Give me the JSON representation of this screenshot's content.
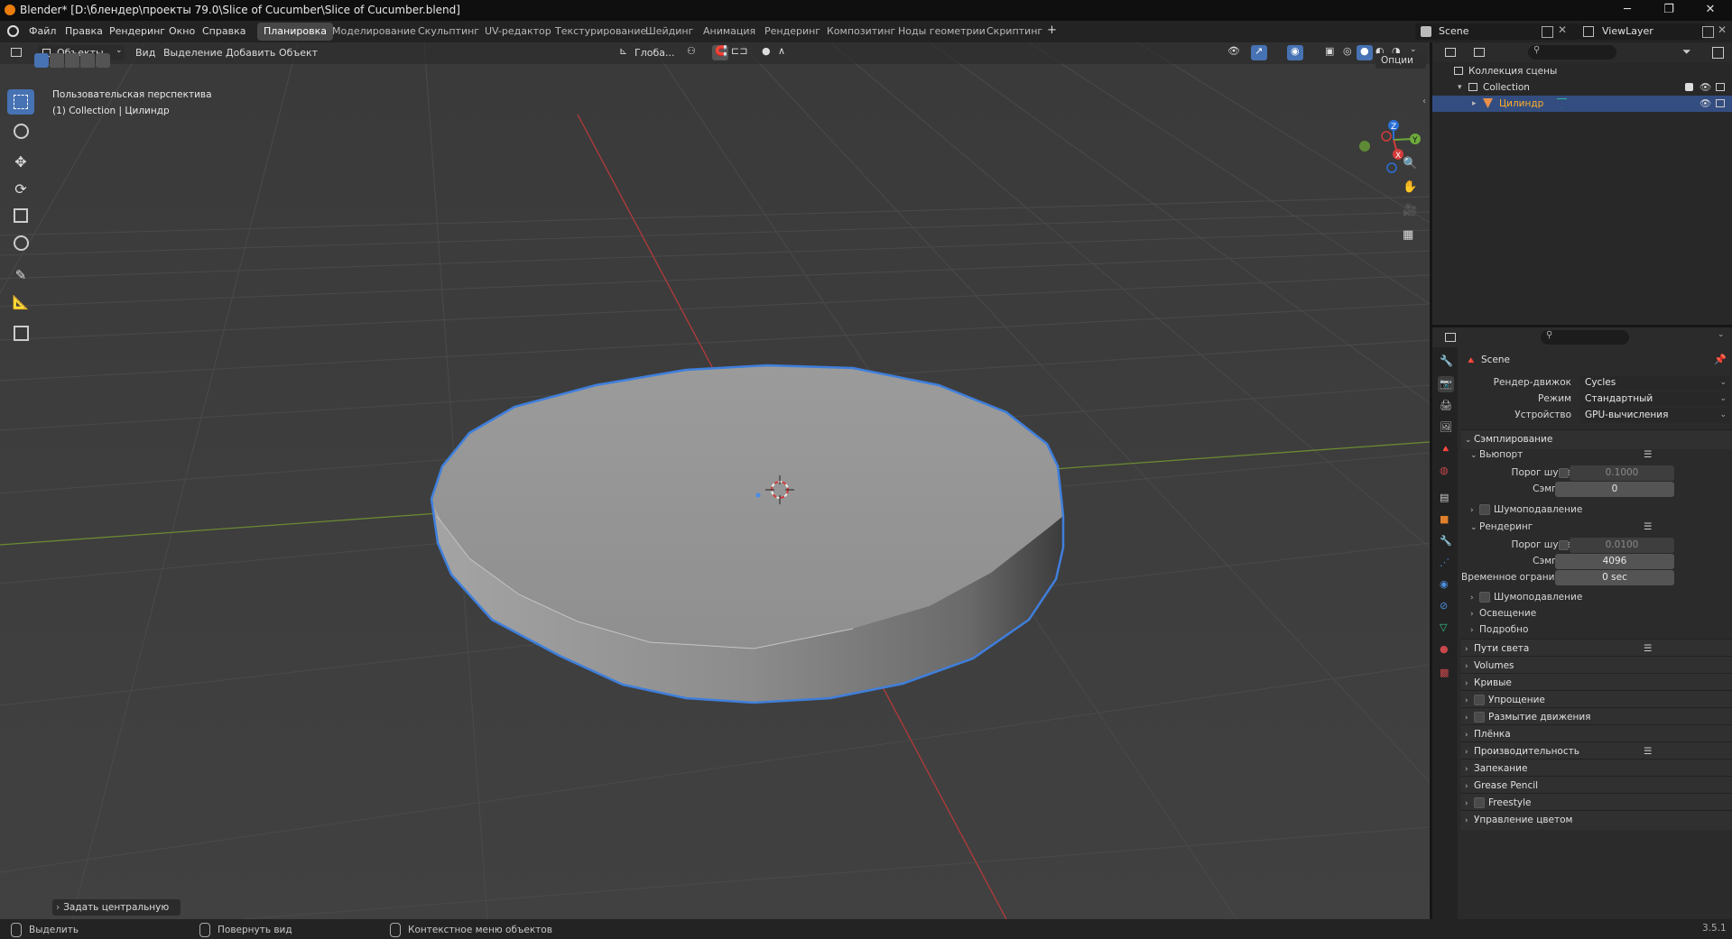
{
  "window": {
    "title": "Blender* [D:\\блендер\\проекты 79.0\\Slice of Cucumber\\Slice of Cucumber.blend]",
    "minimize": "─",
    "maximize": "❐",
    "close": "✕"
  },
  "topbar": {
    "menus": [
      "Файл",
      "Правка",
      "Рендеринг",
      "Окно",
      "Справка"
    ],
    "workspaces": [
      "Планировка",
      "Моделирование",
      "Скульптинг",
      "UV-редактор",
      "Текстурирование",
      "Шейдинг",
      "Анимация",
      "Рендеринг",
      "Композитинг",
      "Ноды геометрии",
      "Скриптинг"
    ],
    "active_workspace_index": 0,
    "add_workspace": "+",
    "scene": "Scene",
    "view_layer": "ViewLayer"
  },
  "viewport_header": {
    "mode": "Объекты",
    "menus": [
      "Вид",
      "Выделение",
      "Добавить",
      "Объект"
    ],
    "transform_orientation": "Глоба...",
    "options": "Опции"
  },
  "viewport": {
    "view_name": "Пользовательская перспектива",
    "collection_info": "(1) Collection | Цилиндр",
    "last_operator": "Задать центральную точ",
    "accent_color": "#4772b3",
    "selection_outline_color": "#3f7fdc"
  },
  "outliner": {
    "root": "Коллекция сцены",
    "collection": "Collection",
    "object": "Цилиндр"
  },
  "properties": {
    "context_name": "Scene",
    "render_engine_label": "Рендер-движок",
    "render_engine": "Cycles",
    "mode_label": "Режим",
    "mode": "Стандартный",
    "device_label": "Устройство",
    "device": "GPU-вычисления",
    "sampling": "Сэмплирование",
    "viewport": "Вьюпорт",
    "noise_threshold_label": "Порог шума",
    "viewport_noise_threshold": "0.1000",
    "samples_label": "Сэмплы",
    "viewport_samples": "0",
    "denoise": "Шумоподавление",
    "render": "Рендеринг",
    "render_noise_threshold": "0.0100",
    "render_samples": "4096",
    "time_limit_label": "Временное огранич...",
    "time_limit": "0 sec",
    "lighting": "Освещение",
    "advanced": "Подробно",
    "panels": [
      "Пути света",
      "Volumes",
      "Кривые",
      "Упрощение",
      "Размытие движения",
      "Плёнка",
      "Производительность",
      "Запекание",
      "Grease Pencil",
      "Freestyle",
      "Управление цветом"
    ]
  },
  "statusbar": {
    "select": "Выделить",
    "rotate_view": "Повернуть вид",
    "context_menu": "Контекстное меню объектов",
    "version": "3.5.1"
  }
}
